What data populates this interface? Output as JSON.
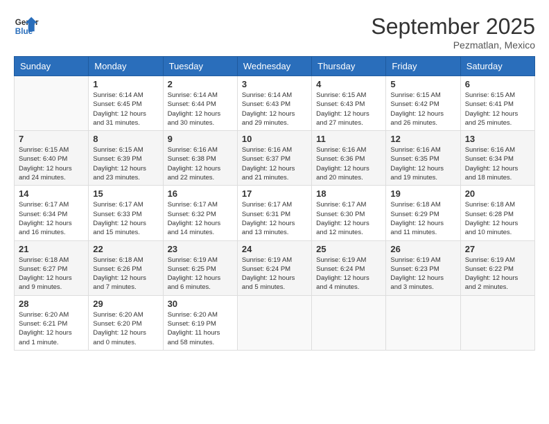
{
  "header": {
    "logo_line1": "General",
    "logo_line2": "Blue",
    "month": "September 2025",
    "location": "Pezmatlan, Mexico"
  },
  "weekdays": [
    "Sunday",
    "Monday",
    "Tuesday",
    "Wednesday",
    "Thursday",
    "Friday",
    "Saturday"
  ],
  "weeks": [
    [
      {
        "day": "",
        "info": ""
      },
      {
        "day": "1",
        "info": "Sunrise: 6:14 AM\nSunset: 6:45 PM\nDaylight: 12 hours\nand 31 minutes."
      },
      {
        "day": "2",
        "info": "Sunrise: 6:14 AM\nSunset: 6:44 PM\nDaylight: 12 hours\nand 30 minutes."
      },
      {
        "day": "3",
        "info": "Sunrise: 6:14 AM\nSunset: 6:43 PM\nDaylight: 12 hours\nand 29 minutes."
      },
      {
        "day": "4",
        "info": "Sunrise: 6:15 AM\nSunset: 6:43 PM\nDaylight: 12 hours\nand 27 minutes."
      },
      {
        "day": "5",
        "info": "Sunrise: 6:15 AM\nSunset: 6:42 PM\nDaylight: 12 hours\nand 26 minutes."
      },
      {
        "day": "6",
        "info": "Sunrise: 6:15 AM\nSunset: 6:41 PM\nDaylight: 12 hours\nand 25 minutes."
      }
    ],
    [
      {
        "day": "7",
        "info": "Sunrise: 6:15 AM\nSunset: 6:40 PM\nDaylight: 12 hours\nand 24 minutes."
      },
      {
        "day": "8",
        "info": "Sunrise: 6:15 AM\nSunset: 6:39 PM\nDaylight: 12 hours\nand 23 minutes."
      },
      {
        "day": "9",
        "info": "Sunrise: 6:16 AM\nSunset: 6:38 PM\nDaylight: 12 hours\nand 22 minutes."
      },
      {
        "day": "10",
        "info": "Sunrise: 6:16 AM\nSunset: 6:37 PM\nDaylight: 12 hours\nand 21 minutes."
      },
      {
        "day": "11",
        "info": "Sunrise: 6:16 AM\nSunset: 6:36 PM\nDaylight: 12 hours\nand 20 minutes."
      },
      {
        "day": "12",
        "info": "Sunrise: 6:16 AM\nSunset: 6:35 PM\nDaylight: 12 hours\nand 19 minutes."
      },
      {
        "day": "13",
        "info": "Sunrise: 6:16 AM\nSunset: 6:34 PM\nDaylight: 12 hours\nand 18 minutes."
      }
    ],
    [
      {
        "day": "14",
        "info": "Sunrise: 6:17 AM\nSunset: 6:34 PM\nDaylight: 12 hours\nand 16 minutes."
      },
      {
        "day": "15",
        "info": "Sunrise: 6:17 AM\nSunset: 6:33 PM\nDaylight: 12 hours\nand 15 minutes."
      },
      {
        "day": "16",
        "info": "Sunrise: 6:17 AM\nSunset: 6:32 PM\nDaylight: 12 hours\nand 14 minutes."
      },
      {
        "day": "17",
        "info": "Sunrise: 6:17 AM\nSunset: 6:31 PM\nDaylight: 12 hours\nand 13 minutes."
      },
      {
        "day": "18",
        "info": "Sunrise: 6:17 AM\nSunset: 6:30 PM\nDaylight: 12 hours\nand 12 minutes."
      },
      {
        "day": "19",
        "info": "Sunrise: 6:18 AM\nSunset: 6:29 PM\nDaylight: 12 hours\nand 11 minutes."
      },
      {
        "day": "20",
        "info": "Sunrise: 6:18 AM\nSunset: 6:28 PM\nDaylight: 12 hours\nand 10 minutes."
      }
    ],
    [
      {
        "day": "21",
        "info": "Sunrise: 6:18 AM\nSunset: 6:27 PM\nDaylight: 12 hours\nand 9 minutes."
      },
      {
        "day": "22",
        "info": "Sunrise: 6:18 AM\nSunset: 6:26 PM\nDaylight: 12 hours\nand 7 minutes."
      },
      {
        "day": "23",
        "info": "Sunrise: 6:19 AM\nSunset: 6:25 PM\nDaylight: 12 hours\nand 6 minutes."
      },
      {
        "day": "24",
        "info": "Sunrise: 6:19 AM\nSunset: 6:24 PM\nDaylight: 12 hours\nand 5 minutes."
      },
      {
        "day": "25",
        "info": "Sunrise: 6:19 AM\nSunset: 6:24 PM\nDaylight: 12 hours\nand 4 minutes."
      },
      {
        "day": "26",
        "info": "Sunrise: 6:19 AM\nSunset: 6:23 PM\nDaylight: 12 hours\nand 3 minutes."
      },
      {
        "day": "27",
        "info": "Sunrise: 6:19 AM\nSunset: 6:22 PM\nDaylight: 12 hours\nand 2 minutes."
      }
    ],
    [
      {
        "day": "28",
        "info": "Sunrise: 6:20 AM\nSunset: 6:21 PM\nDaylight: 12 hours\nand 1 minute."
      },
      {
        "day": "29",
        "info": "Sunrise: 6:20 AM\nSunset: 6:20 PM\nDaylight: 12 hours\nand 0 minutes."
      },
      {
        "day": "30",
        "info": "Sunrise: 6:20 AM\nSunset: 6:19 PM\nDaylight: 11 hours\nand 58 minutes."
      },
      {
        "day": "",
        "info": ""
      },
      {
        "day": "",
        "info": ""
      },
      {
        "day": "",
        "info": ""
      },
      {
        "day": "",
        "info": ""
      }
    ]
  ]
}
